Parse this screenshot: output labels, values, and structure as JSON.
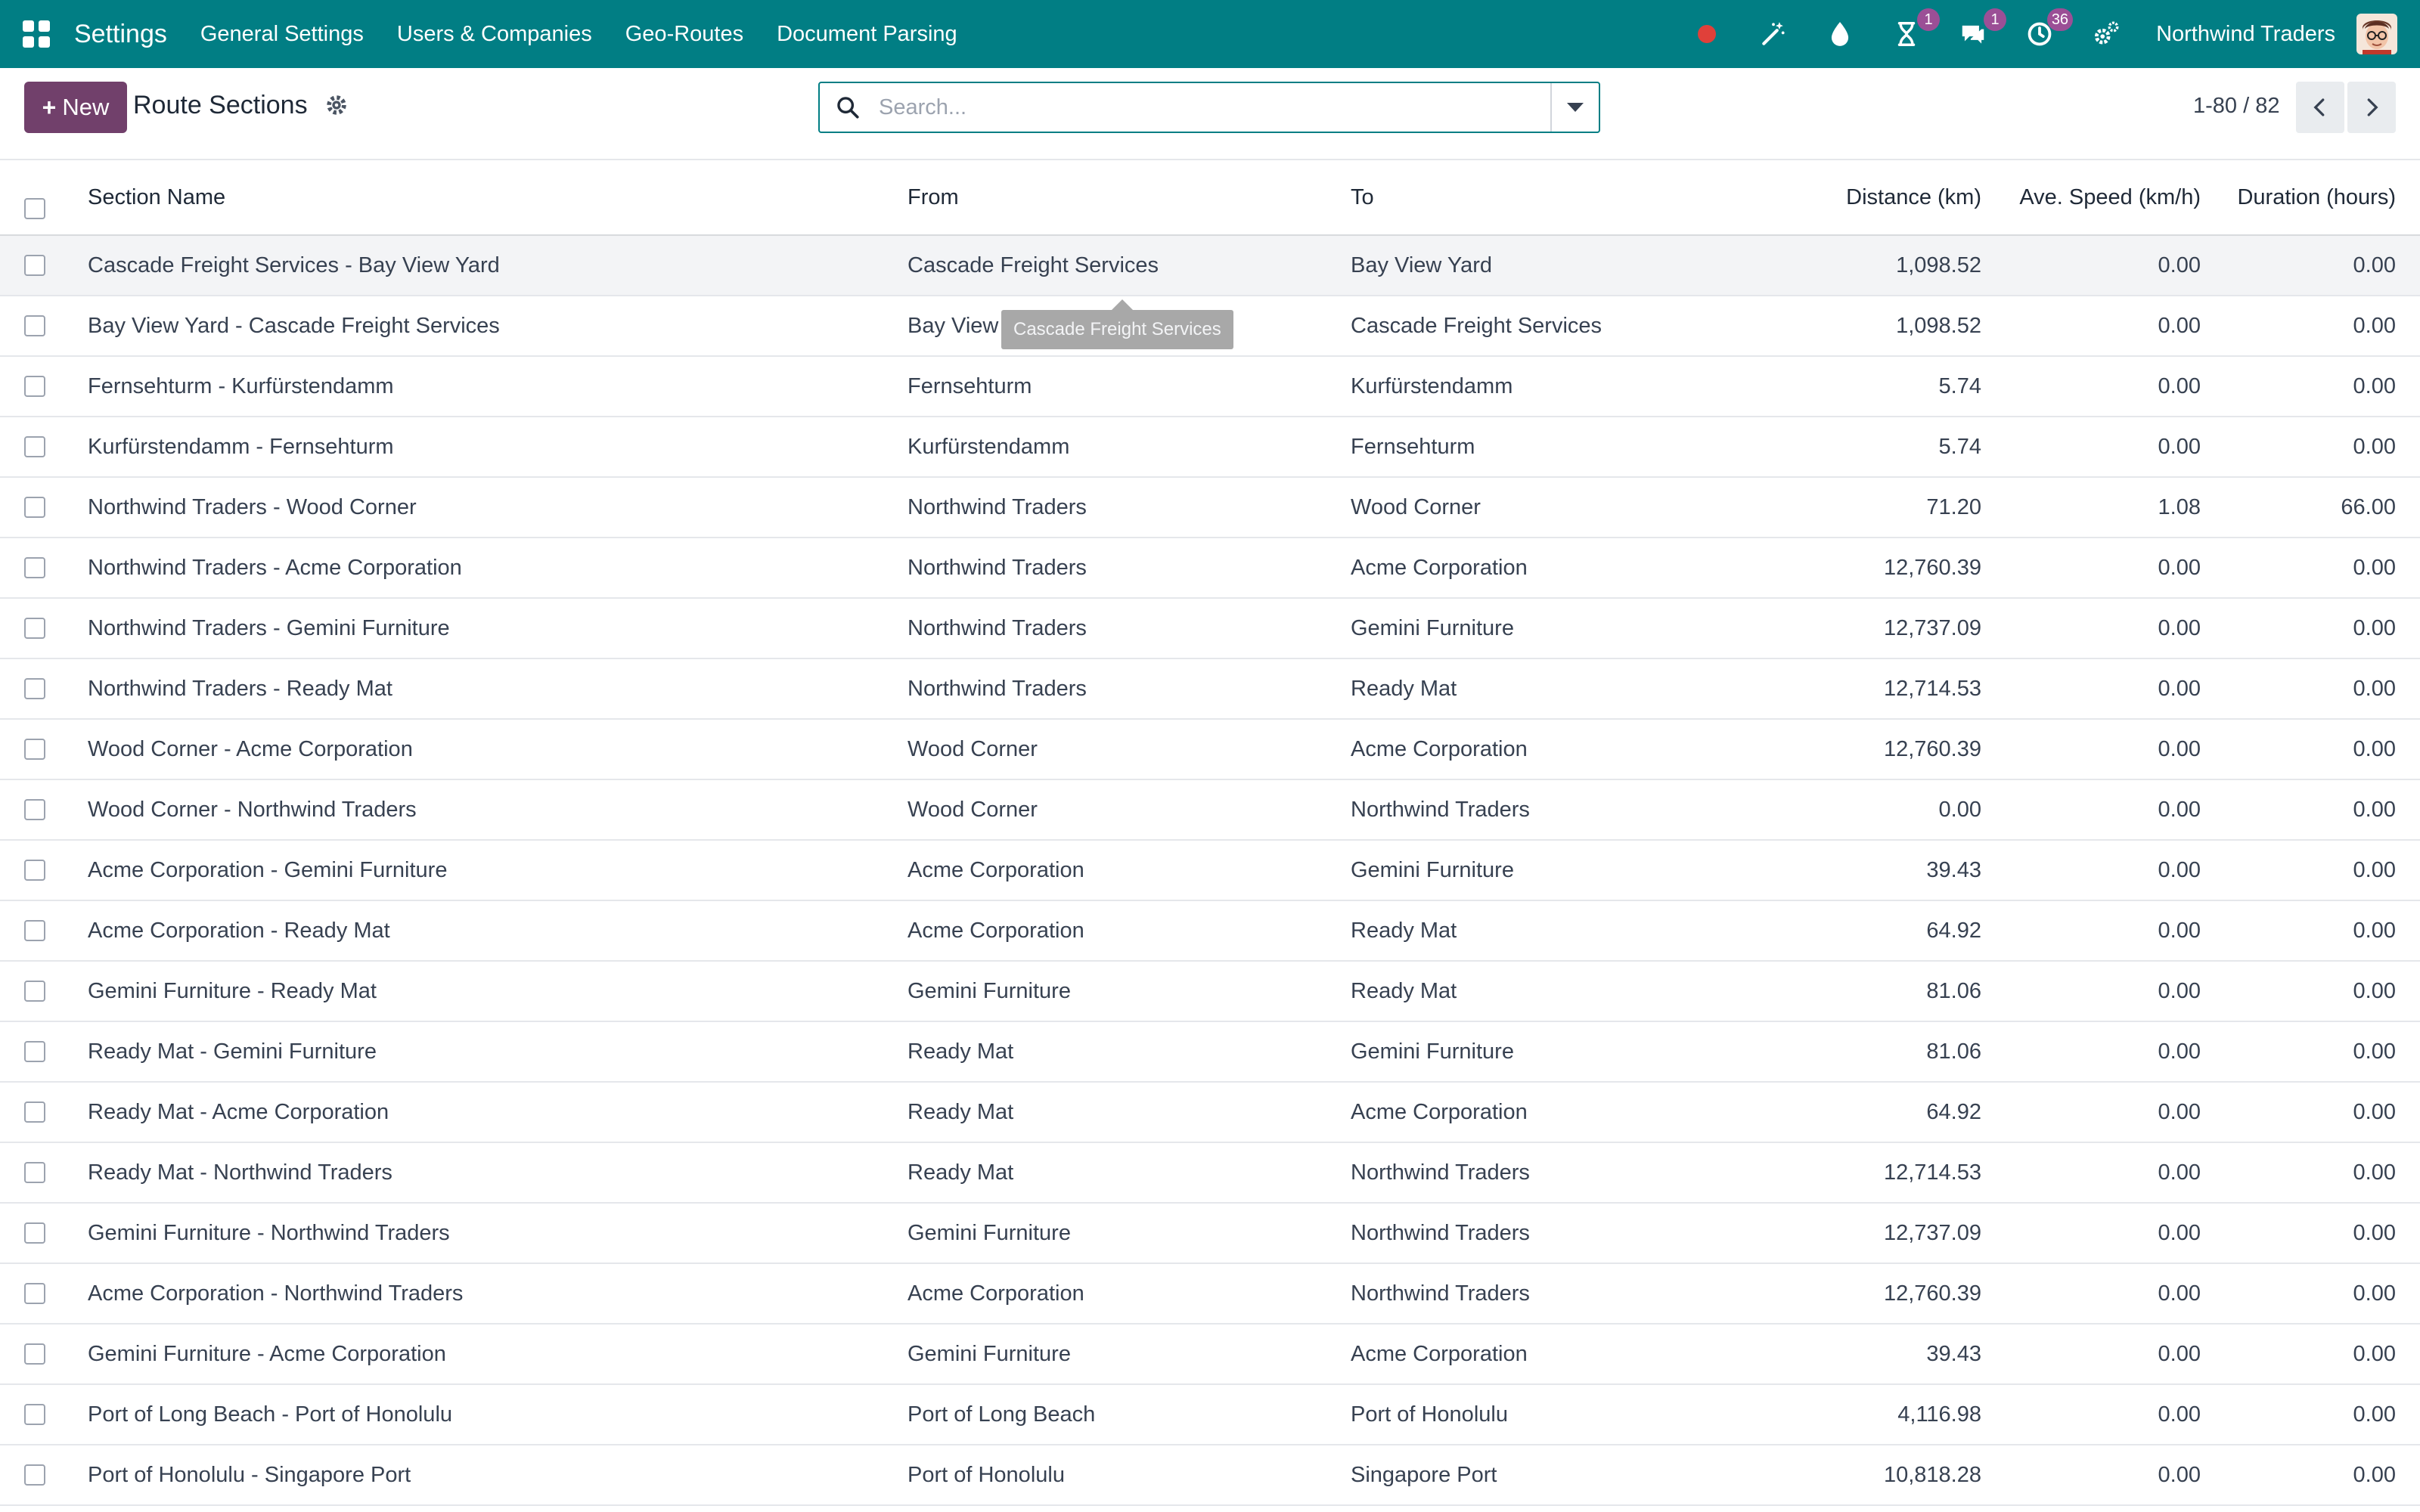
{
  "navbar": {
    "brand": "Settings",
    "menus": [
      "General Settings",
      "Users & Companies",
      "Geo-Routes",
      "Document Parsing"
    ],
    "activities_badge": "1",
    "messages_badge": "1",
    "timer_badge": "36",
    "company": "Northwind Traders"
  },
  "control": {
    "new_label": "New",
    "title": "Route Sections",
    "search_placeholder": "Search...",
    "pager": "1-80 / 82"
  },
  "table": {
    "headers": {
      "name": "Section Name",
      "from": "From",
      "to": "To",
      "distance": "Distance (km)",
      "speed": "Ave. Speed (km/h)",
      "duration": "Duration (hours)"
    },
    "rows": [
      {
        "name": "Cascade Freight Services - Bay View Yard",
        "from": "Cascade Freight Services",
        "to": "Bay View Yard",
        "distance": "1,098.52",
        "speed": "0.00",
        "duration": "0.00"
      },
      {
        "name": "Bay View Yard - Cascade Freight Services",
        "from": "Bay View Yard",
        "to": "Cascade Freight Services",
        "distance": "1,098.52",
        "speed": "0.00",
        "duration": "0.00"
      },
      {
        "name": "Fernsehturm - Kurfürstendamm",
        "from": "Fernsehturm",
        "to": "Kurfürstendamm",
        "distance": "5.74",
        "speed": "0.00",
        "duration": "0.00"
      },
      {
        "name": "Kurfürstendamm - Fernsehturm",
        "from": "Kurfürstendamm",
        "to": "Fernsehturm",
        "distance": "5.74",
        "speed": "0.00",
        "duration": "0.00"
      },
      {
        "name": "Northwind Traders - Wood Corner",
        "from": "Northwind Traders",
        "to": "Wood Corner",
        "distance": "71.20",
        "speed": "1.08",
        "duration": "66.00"
      },
      {
        "name": "Northwind Traders - Acme Corporation",
        "from": "Northwind Traders",
        "to": "Acme Corporation",
        "distance": "12,760.39",
        "speed": "0.00",
        "duration": "0.00"
      },
      {
        "name": "Northwind Traders - Gemini Furniture",
        "from": "Northwind Traders",
        "to": "Gemini Furniture",
        "distance": "12,737.09",
        "speed": "0.00",
        "duration": "0.00"
      },
      {
        "name": "Northwind Traders - Ready Mat",
        "from": "Northwind Traders",
        "to": "Ready Mat",
        "distance": "12,714.53",
        "speed": "0.00",
        "duration": "0.00"
      },
      {
        "name": "Wood Corner - Acme Corporation",
        "from": "Wood Corner",
        "to": "Acme Corporation",
        "distance": "12,760.39",
        "speed": "0.00",
        "duration": "0.00"
      },
      {
        "name": "Wood Corner - Northwind Traders",
        "from": "Wood Corner",
        "to": "Northwind Traders",
        "distance": "0.00",
        "speed": "0.00",
        "duration": "0.00"
      },
      {
        "name": "Acme Corporation - Gemini Furniture",
        "from": "Acme Corporation",
        "to": "Gemini Furniture",
        "distance": "39.43",
        "speed": "0.00",
        "duration": "0.00"
      },
      {
        "name": "Acme Corporation - Ready Mat",
        "from": "Acme Corporation",
        "to": "Ready Mat",
        "distance": "64.92",
        "speed": "0.00",
        "duration": "0.00"
      },
      {
        "name": "Gemini Furniture - Ready Mat",
        "from": "Gemini Furniture",
        "to": "Ready Mat",
        "distance": "81.06",
        "speed": "0.00",
        "duration": "0.00"
      },
      {
        "name": "Ready Mat - Gemini Furniture",
        "from": "Ready Mat",
        "to": "Gemini Furniture",
        "distance": "81.06",
        "speed": "0.00",
        "duration": "0.00"
      },
      {
        "name": "Ready Mat - Acme Corporation",
        "from": "Ready Mat",
        "to": "Acme Corporation",
        "distance": "64.92",
        "speed": "0.00",
        "duration": "0.00"
      },
      {
        "name": "Ready Mat - Northwind Traders",
        "from": "Ready Mat",
        "to": "Northwind Traders",
        "distance": "12,714.53",
        "speed": "0.00",
        "duration": "0.00"
      },
      {
        "name": "Gemini Furniture - Northwind Traders",
        "from": "Gemini Furniture",
        "to": "Northwind Traders",
        "distance": "12,737.09",
        "speed": "0.00",
        "duration": "0.00"
      },
      {
        "name": "Acme Corporation - Northwind Traders",
        "from": "Acme Corporation",
        "to": "Northwind Traders",
        "distance": "12,760.39",
        "speed": "0.00",
        "duration": "0.00"
      },
      {
        "name": "Gemini Furniture - Acme Corporation",
        "from": "Gemini Furniture",
        "to": "Acme Corporation",
        "distance": "39.43",
        "speed": "0.00",
        "duration": "0.00"
      },
      {
        "name": "Port of Long Beach - Port of Honolulu",
        "from": "Port of Long Beach",
        "to": "Port of Honolulu",
        "distance": "4,116.98",
        "speed": "0.00",
        "duration": "0.00"
      },
      {
        "name": "Port of Honolulu - Singapore Port",
        "from": "Port of Honolulu",
        "to": "Singapore Port",
        "distance": "10,818.28",
        "speed": "0.00",
        "duration": "0.00"
      }
    ]
  },
  "tooltip": {
    "text": "Cascade Freight Services"
  },
  "colors": {
    "navbar": "#017e84",
    "primary_button": "#71406b",
    "badge": "#9b4f96",
    "record_dot": "#e0403a"
  }
}
